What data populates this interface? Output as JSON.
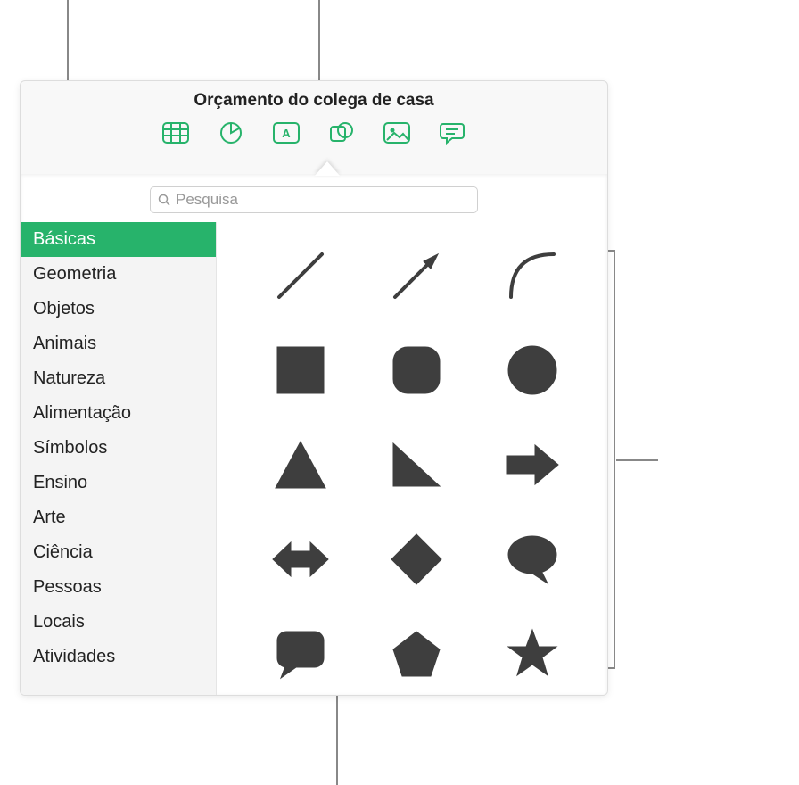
{
  "window": {
    "title": "Orçamento do colega de casa"
  },
  "toolbar": {
    "items": [
      {
        "name": "table-icon"
      },
      {
        "name": "chart-icon"
      },
      {
        "name": "text-box-icon"
      },
      {
        "name": "shape-icon",
        "selected": true
      },
      {
        "name": "media-icon"
      },
      {
        "name": "comment-icon"
      }
    ]
  },
  "search": {
    "placeholder": "Pesquisa",
    "value": ""
  },
  "sidebar": {
    "selected_index": 0,
    "items": [
      {
        "label": "Básicas"
      },
      {
        "label": "Geometria"
      },
      {
        "label": "Objetos"
      },
      {
        "label": "Animais"
      },
      {
        "label": "Natureza"
      },
      {
        "label": "Alimentação"
      },
      {
        "label": "Símbolos"
      },
      {
        "label": "Ensino"
      },
      {
        "label": "Arte"
      },
      {
        "label": "Ciência"
      },
      {
        "label": "Pessoas"
      },
      {
        "label": "Locais"
      },
      {
        "label": "Atividades"
      }
    ]
  },
  "shapes": [
    {
      "name": "line"
    },
    {
      "name": "arrow-line"
    },
    {
      "name": "curve"
    },
    {
      "name": "square"
    },
    {
      "name": "rounded-square"
    },
    {
      "name": "circle"
    },
    {
      "name": "triangle"
    },
    {
      "name": "right-triangle"
    },
    {
      "name": "arrow-right"
    },
    {
      "name": "arrow-left-right"
    },
    {
      "name": "diamond"
    },
    {
      "name": "speech-bubble-round"
    },
    {
      "name": "speech-bubble-square"
    },
    {
      "name": "pentagon"
    },
    {
      "name": "star"
    }
  ],
  "colors": {
    "accent": "#27b36b",
    "shape_fill": "#3E3E3E"
  }
}
